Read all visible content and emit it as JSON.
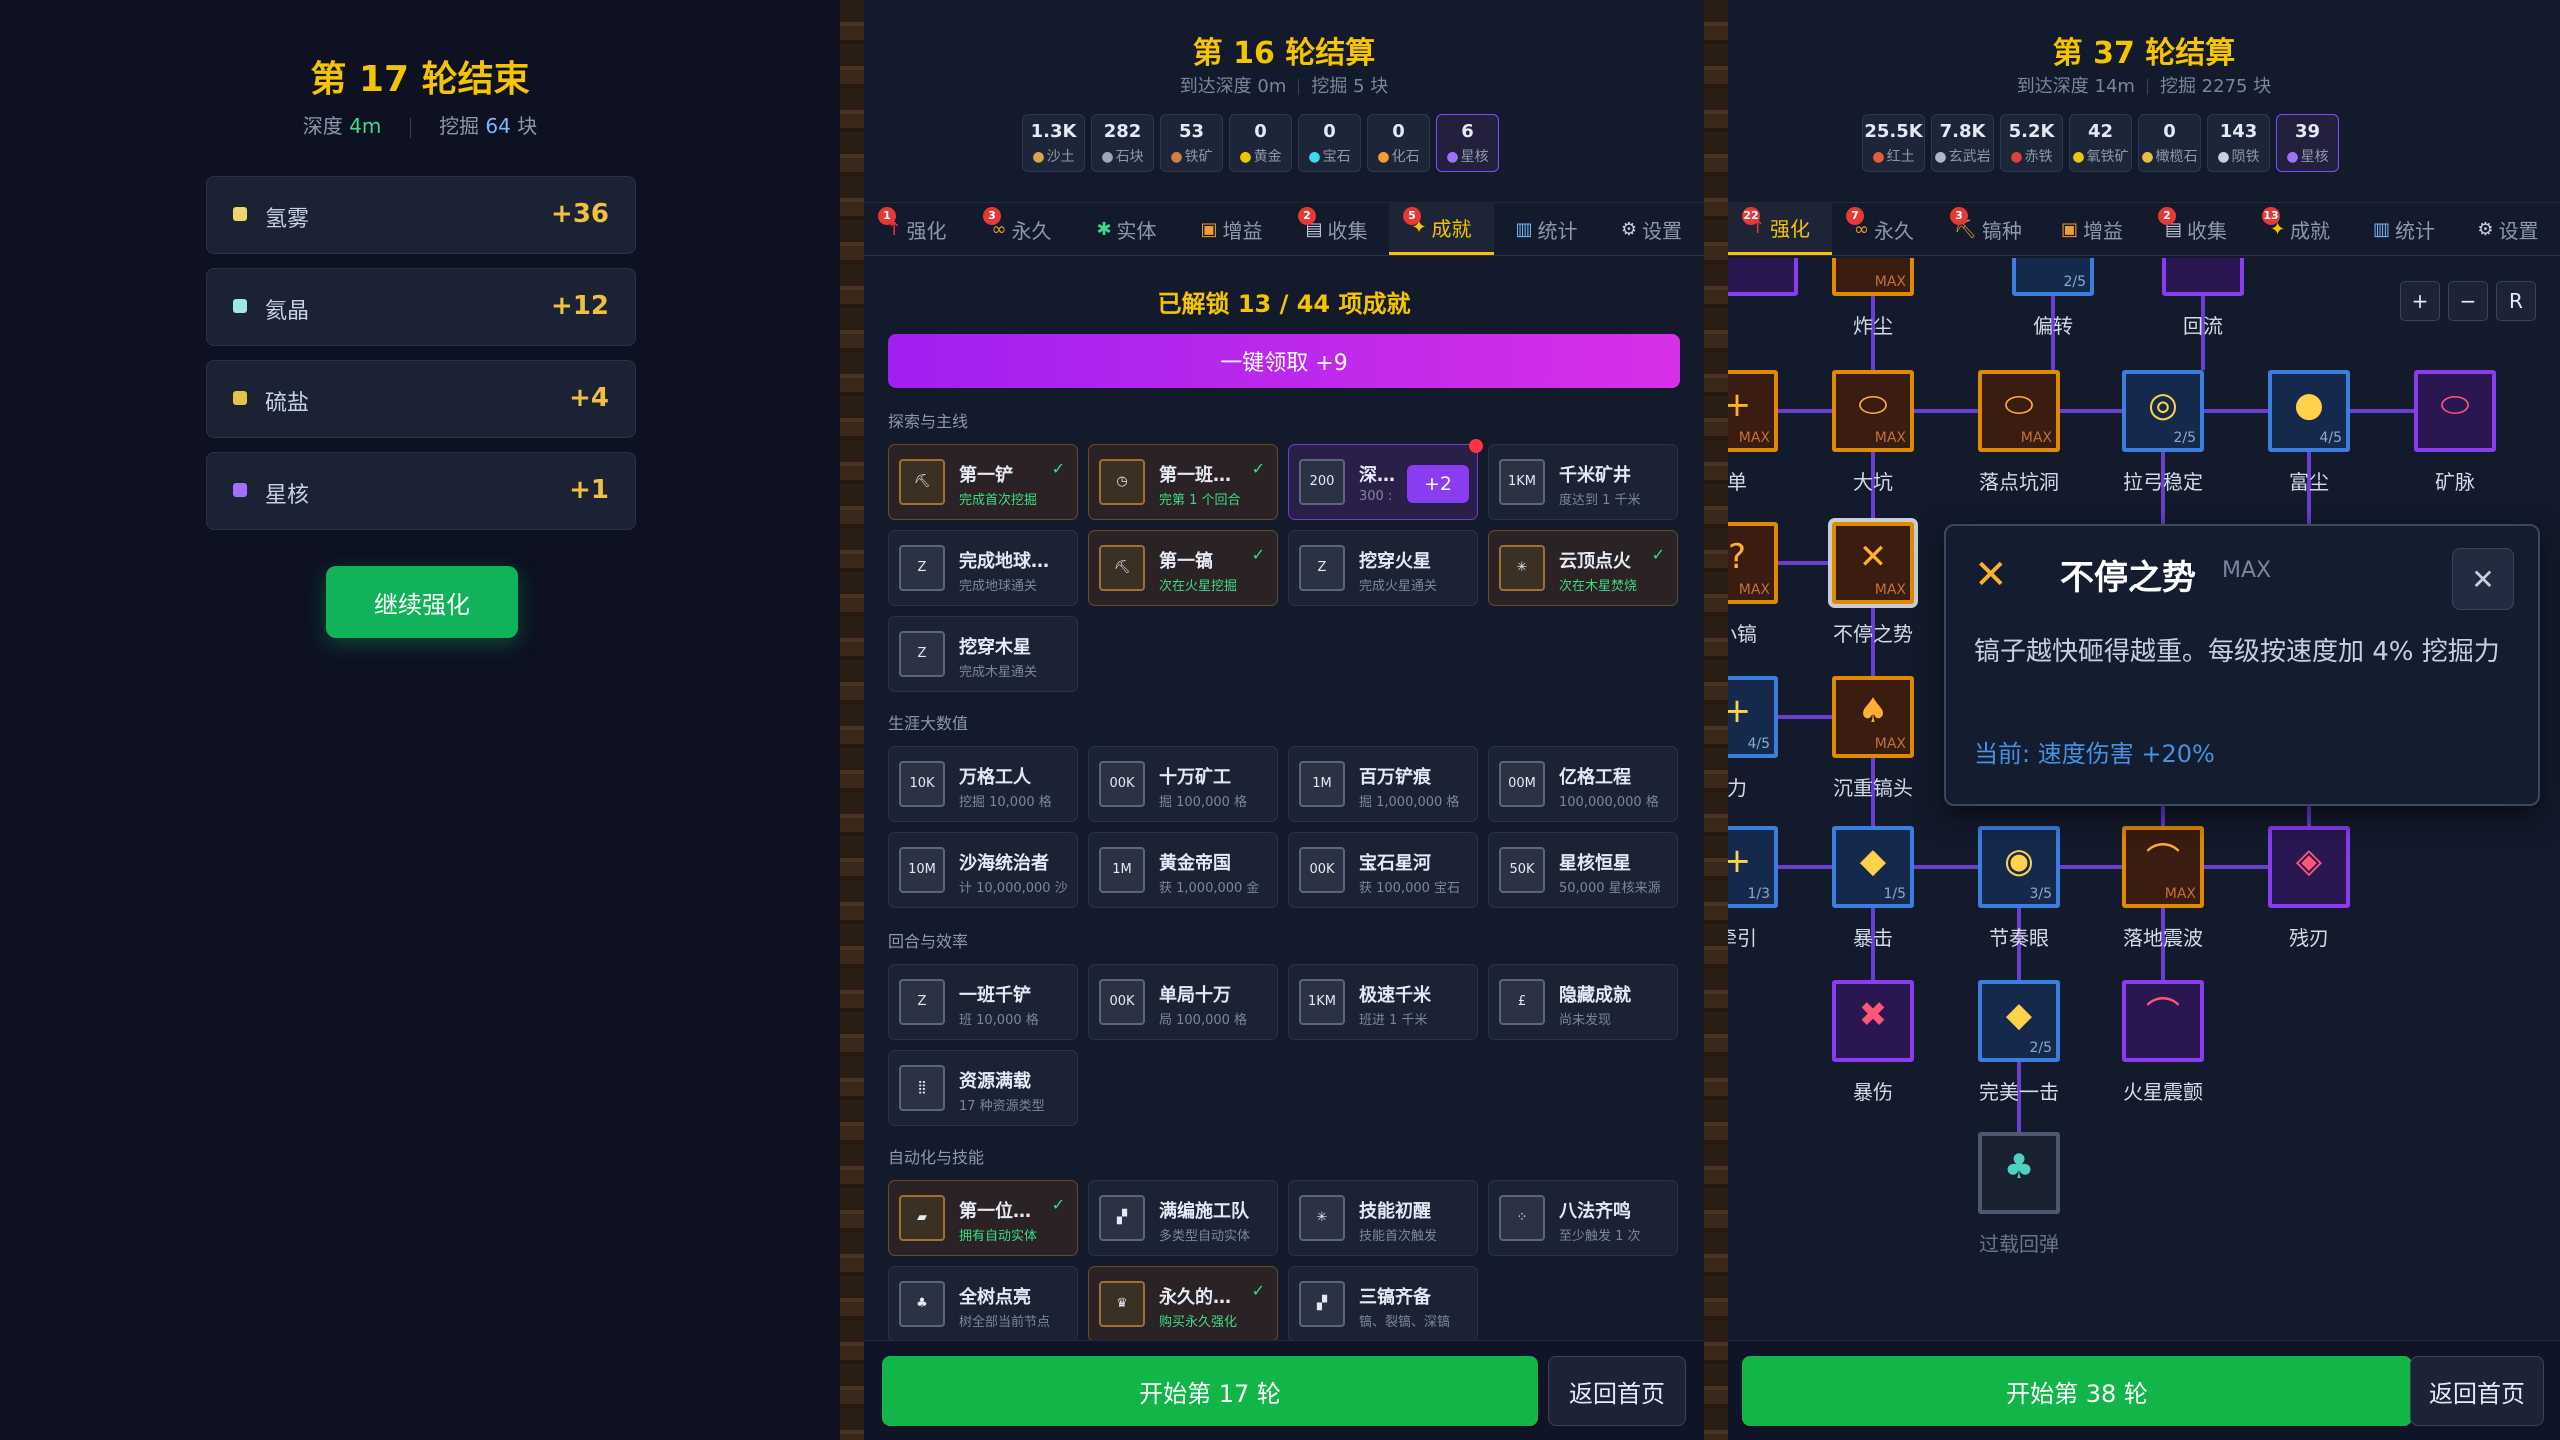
{
  "left_panel": {
    "title": "第 17 轮结束",
    "depth_label": "深度",
    "depth_value": "4m",
    "dug_label": "挖掘",
    "dug_value": "64",
    "dug_unit": "块",
    "rewards": [
      {
        "name": "氢雾",
        "value": "+36",
        "color": "#f3d46a"
      },
      {
        "name": "氦晶",
        "value": "+12",
        "color": "#9ee8e0"
      },
      {
        "name": "硫盐",
        "value": "+4",
        "color": "#e6c24a"
      },
      {
        "name": "星核",
        "value": "+1",
        "color": "#a070ff"
      }
    ],
    "continue_button": "继续强化"
  },
  "middle_panel": {
    "title": "第 16 轮结算",
    "reached_depth": "到达深度 0m",
    "dug": "挖掘 5 块",
    "resources": [
      {
        "value": "1.3K",
        "label": "沙土",
        "icon": "sand-icon",
        "color": "#d9a44a"
      },
      {
        "value": "282",
        "label": "石块",
        "icon": "stone-icon",
        "color": "#a0a8b8"
      },
      {
        "value": "53",
        "label": "铁矿",
        "icon": "iron-icon",
        "color": "#d08040"
      },
      {
        "value": "0",
        "label": "黄金",
        "icon": "gold-icon",
        "color": "#f5c400"
      },
      {
        "value": "0",
        "label": "宝石",
        "icon": "gem-icon",
        "color": "#40d8f0"
      },
      {
        "value": "0",
        "label": "化石",
        "icon": "fossil-icon",
        "color": "#f0a030"
      },
      {
        "value": "6",
        "label": "星核",
        "icon": "star-core-icon",
        "color": "#a070ff",
        "highlight": true
      }
    ],
    "tabs": [
      {
        "label": "强化",
        "icon": "↑",
        "badge": "1",
        "color": "#e53935"
      },
      {
        "label": "永久",
        "icon": "∞",
        "badge": "3",
        "color": "#e8a030"
      },
      {
        "label": "实体",
        "icon": "✱",
        "badge": "",
        "color": "#3ddc84"
      },
      {
        "label": "增益",
        "icon": "▣",
        "badge": "",
        "color": "#f0a030"
      },
      {
        "label": "收集",
        "icon": "▤",
        "badge": "2",
        "color": "#c8d0e0"
      },
      {
        "label": "成就",
        "icon": "✦",
        "badge": "5",
        "color": "#f5c400",
        "active": true
      },
      {
        "label": "统计",
        "icon": "▥",
        "badge": "",
        "color": "#78b8ff"
      },
      {
        "label": "设置",
        "icon": "⚙",
        "badge": "",
        "color": "#c8d0e0"
      }
    ],
    "unlocked_text": "已解锁 13 / 44 项成就",
    "claim_all": "一键领取 +9",
    "sections": [
      {
        "title": "探索与主线",
        "items": [
          {
            "name": "第一铲",
            "desc": "完成首次挖掘",
            "icon": "shovel",
            "glyph": "⛏",
            "done": true
          },
          {
            "name": "第一班…",
            "desc": "完第 1 个回合",
            "icon": "clock",
            "glyph": "◷",
            "done": true
          },
          {
            "name": "深…",
            "desc": "300 :",
            "icon": "depth-200",
            "glyph": "200",
            "claim": "+2"
          },
          {
            "name": "千米矿井",
            "desc": "度达到 1 千米",
            "icon": "1km",
            "glyph": "1KM"
          },
          {
            "name": "完成地球…",
            "desc": "完成地球通关",
            "icon": "earth",
            "glyph": "Z"
          },
          {
            "name": "第一镐",
            "desc": "次在火星挖掘",
            "icon": "pickaxe",
            "glyph": "⛏",
            "done": true
          },
          {
            "name": "挖穿火星",
            "desc": "完成火星通关",
            "icon": "mars",
            "glyph": "Z"
          },
          {
            "name": "云顶点火",
            "desc": "次在木星焚烧",
            "icon": "burst",
            "glyph": "✳",
            "done": true
          },
          {
            "name": "挖穿木星",
            "desc": "完成木星通关",
            "icon": "jupiter",
            "glyph": "Z"
          }
        ]
      },
      {
        "title": "生涯大数值",
        "items": [
          {
            "name": "万格工人",
            "desc": "挖掘 10,000 格",
            "icon": "10k",
            "glyph": "10K"
          },
          {
            "name": "十万矿工",
            "desc": "掘 100,000 格",
            "icon": "00k",
            "glyph": "00K"
          },
          {
            "name": "百万铲痕",
            "desc": "掘 1,000,000 格",
            "icon": "1m",
            "glyph": "1M"
          },
          {
            "name": "亿格工程",
            "desc": "100,000,000 格",
            "icon": "00m",
            "glyph": "00M"
          },
          {
            "name": "沙海统治者",
            "desc": "计 10,000,000 沙",
            "icon": "10m",
            "glyph": "10M"
          },
          {
            "name": "黄金帝国",
            "desc": "获 1,000,000 金",
            "icon": "1m-gold",
            "glyph": "1M"
          },
          {
            "name": "宝石星河",
            "desc": "获 100,000 宝石",
            "icon": "00k-gem",
            "glyph": "00K"
          },
          {
            "name": "星核恒星",
            "desc": "50,000 星核来源",
            "icon": "50k",
            "glyph": "50K"
          }
        ]
      },
      {
        "title": "回合与效率",
        "items": [
          {
            "name": "一班千铲",
            "desc": "班 10,000 格",
            "icon": "z",
            "glyph": "Z"
          },
          {
            "name": "单局十万",
            "desc": "局 100,000 格",
            "icon": "00k-run",
            "glyph": "00K"
          },
          {
            "name": "极速千米",
            "desc": "班进 1 千米",
            "icon": "1km-fast",
            "glyph": "1KM"
          },
          {
            "name": "隐藏成就",
            "desc": "尚未发现",
            "icon": "hidden",
            "glyph": "£"
          },
          {
            "name": "资源满载",
            "desc": "17 种资源类型",
            "icon": "dots",
            "glyph": "⣿"
          }
        ]
      },
      {
        "title": "自动化与技能",
        "items": [
          {
            "name": "第一位…",
            "desc": "拥有自动实体",
            "icon": "robot",
            "glyph": "▰",
            "done": true
          },
          {
            "name": "满编施工队",
            "desc": "多类型自动实体",
            "icon": "crew",
            "glyph": "▞"
          },
          {
            "name": "技能初醒",
            "desc": "技能首次触发",
            "icon": "spark",
            "glyph": "✳"
          },
          {
            "name": "八法齐鸣",
            "desc": "至少触发 1 次",
            "icon": "dice",
            "glyph": "⁘"
          },
          {
            "name": "全树点亮",
            "desc": "树全部当前节点",
            "icon": "tree",
            "glyph": "♣"
          },
          {
            "name": "永久的…",
            "desc": "购买永久强化",
            "icon": "crown",
            "glyph": "♛",
            "done": true
          },
          {
            "name": "三镐齐备",
            "desc": "镐、裂镐、深镐",
            "icon": "three-picks",
            "glyph": "▞"
          }
        ]
      }
    ],
    "start_button": "开始第 17 轮",
    "home_button": "返回首页"
  },
  "right_panel": {
    "title": "第 37 轮结算",
    "reached_depth": "到达深度 14m",
    "dug": "挖掘 2275 块",
    "resources": [
      {
        "value": "25.5K",
        "label": "红土",
        "icon": "red-soil-icon",
        "color": "#e0603a"
      },
      {
        "value": "7.8K",
        "label": "玄武岩",
        "icon": "basalt-icon",
        "color": "#b0b8c8"
      },
      {
        "value": "5.2K",
        "label": "赤铁",
        "icon": "hematite-icon",
        "color": "#e04040"
      },
      {
        "value": "42",
        "label": "氧铁矿",
        "icon": "ore-icon",
        "color": "#f5c400"
      },
      {
        "value": "0",
        "label": "橄榄石",
        "icon": "olivine-icon",
        "color": "#e8c040"
      },
      {
        "value": "143",
        "label": "陨铁",
        "icon": "meteor-icon",
        "color": "#c8d0e0"
      },
      {
        "value": "39",
        "label": "星核",
        "icon": "star-core-icon",
        "color": "#a070ff",
        "highlight": true
      }
    ],
    "tabs": [
      {
        "label": "强化",
        "icon": "↑",
        "badge": "22",
        "color": "#e53935",
        "active": true
      },
      {
        "label": "永久",
        "icon": "∞",
        "badge": "7",
        "color": "#e8a030"
      },
      {
        "label": "镐种",
        "icon": "⛏",
        "badge": "3",
        "color": "#e8a030"
      },
      {
        "label": "增益",
        "icon": "▣",
        "badge": "",
        "color": "#f0a030"
      },
      {
        "label": "收集",
        "icon": "▤",
        "badge": "2",
        "color": "#c8d0e0"
      },
      {
        "label": "成就",
        "icon": "✦",
        "badge": "13",
        "color": "#f5c400"
      },
      {
        "label": "统计",
        "icon": "▥",
        "badge": "",
        "color": "#78b8ff"
      },
      {
        "label": "设置",
        "icon": "⚙",
        "badge": "",
        "color": "#c8d0e0"
      }
    ],
    "zoom_buttons": [
      "+",
      "−",
      "R"
    ],
    "nodes": [
      {
        "id": "n0",
        "label": "",
        "level": "",
        "tone": "purple",
        "glyph": ""
      },
      {
        "id": "n1",
        "label": "炸尘",
        "level": "MAX",
        "tone": "orange",
        "glyph": ""
      },
      {
        "id": "n2",
        "label": "偏转",
        "level": "2/5",
        "tone": "blue",
        "glyph": ""
      },
      {
        "id": "n3",
        "label": "回流",
        "level": "",
        "tone": "purple",
        "glyph": ""
      },
      {
        "id": "n4",
        "label": "单",
        "level": "MAX",
        "tone": "orange",
        "glyph": "+"
      },
      {
        "id": "n5",
        "label": "大坑",
        "level": "MAX",
        "tone": "orange",
        "glyph": "⬭"
      },
      {
        "id": "n6",
        "label": "落点坑洞",
        "level": "MAX",
        "tone": "orange",
        "glyph": "⬭"
      },
      {
        "id": "n7",
        "label": "拉弓稳定",
        "level": "2/5",
        "tone": "blue",
        "glyph": "◎"
      },
      {
        "id": "n8",
        "label": "富尘",
        "level": "4/5",
        "tone": "blue",
        "glyph": "●"
      },
      {
        "id": "n9",
        "label": "矿脉",
        "level": "",
        "tone": "purple",
        "glyph": "⬭"
      },
      {
        "id": "n10",
        "label": "小镐",
        "level": "MAX",
        "tone": "orange",
        "glyph": "?"
      },
      {
        "id": "n11",
        "label": "不停之势",
        "level": "MAX",
        "tone": "orange",
        "glyph": "✕",
        "selected": true
      },
      {
        "id": "n12",
        "label": "力",
        "level": "4/5",
        "tone": "blue",
        "glyph": "+"
      },
      {
        "id": "n13",
        "label": "沉重镐头",
        "level": "MAX",
        "tone": "orange",
        "glyph": "♠"
      },
      {
        "id": "n14",
        "label": "牵引",
        "level": "1/3",
        "tone": "blue",
        "glyph": "+"
      },
      {
        "id": "n15",
        "label": "暴击",
        "level": "1/5",
        "tone": "blue",
        "glyph": "◆"
      },
      {
        "id": "n16",
        "label": "节奏眼",
        "level": "3/5",
        "tone": "blue",
        "glyph": "◉"
      },
      {
        "id": "n17",
        "label": "落地震波",
        "level": "MAX",
        "tone": "orange",
        "glyph": "⌒"
      },
      {
        "id": "n18",
        "label": "残刃",
        "level": "",
        "tone": "purple",
        "glyph": "◈"
      },
      {
        "id": "n19",
        "label": "暴伤",
        "level": "",
        "tone": "purple",
        "glyph": "✖"
      },
      {
        "id": "n20",
        "label": "完美一击",
        "level": "2/5",
        "tone": "blue",
        "glyph": "◆"
      },
      {
        "id": "n21",
        "label": "火星震颤",
        "level": "",
        "tone": "purple",
        "glyph": "⌒"
      },
      {
        "id": "n22",
        "label": "过载回弹",
        "level": "",
        "tone": "gray",
        "glyph": "♣",
        "dim": true
      }
    ],
    "popup": {
      "title": "不停之势",
      "max": "MAX",
      "icon": "crossed-picks-icon",
      "description": "镐子越快砸得越重。每级按速度加 4% 挖掘力",
      "current": "当前: 速度伤害 +20%"
    },
    "start_button": "开始第 38 轮",
    "home_button": "返回首页"
  }
}
